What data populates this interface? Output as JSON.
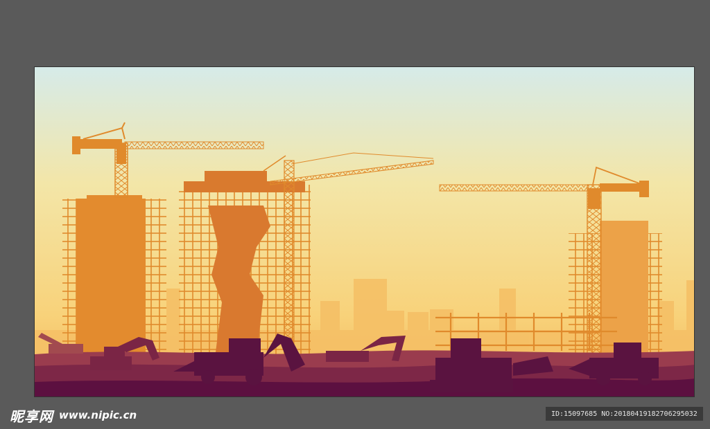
{
  "watermark": {
    "site_name": "昵享网",
    "site_url": "www.nipic.cn",
    "id_text": "ID:15097685 NO:20180419182706295032"
  },
  "colors": {
    "workspace": "#5a5a5a",
    "sky_top": "#d9ecea",
    "sky_bottom": "#f6c46a",
    "crane_orange": "#e08a2c",
    "building_orange": "#d97a2e",
    "ground_dark": "#5e1240",
    "ground_mid": "#7e2a4a"
  }
}
